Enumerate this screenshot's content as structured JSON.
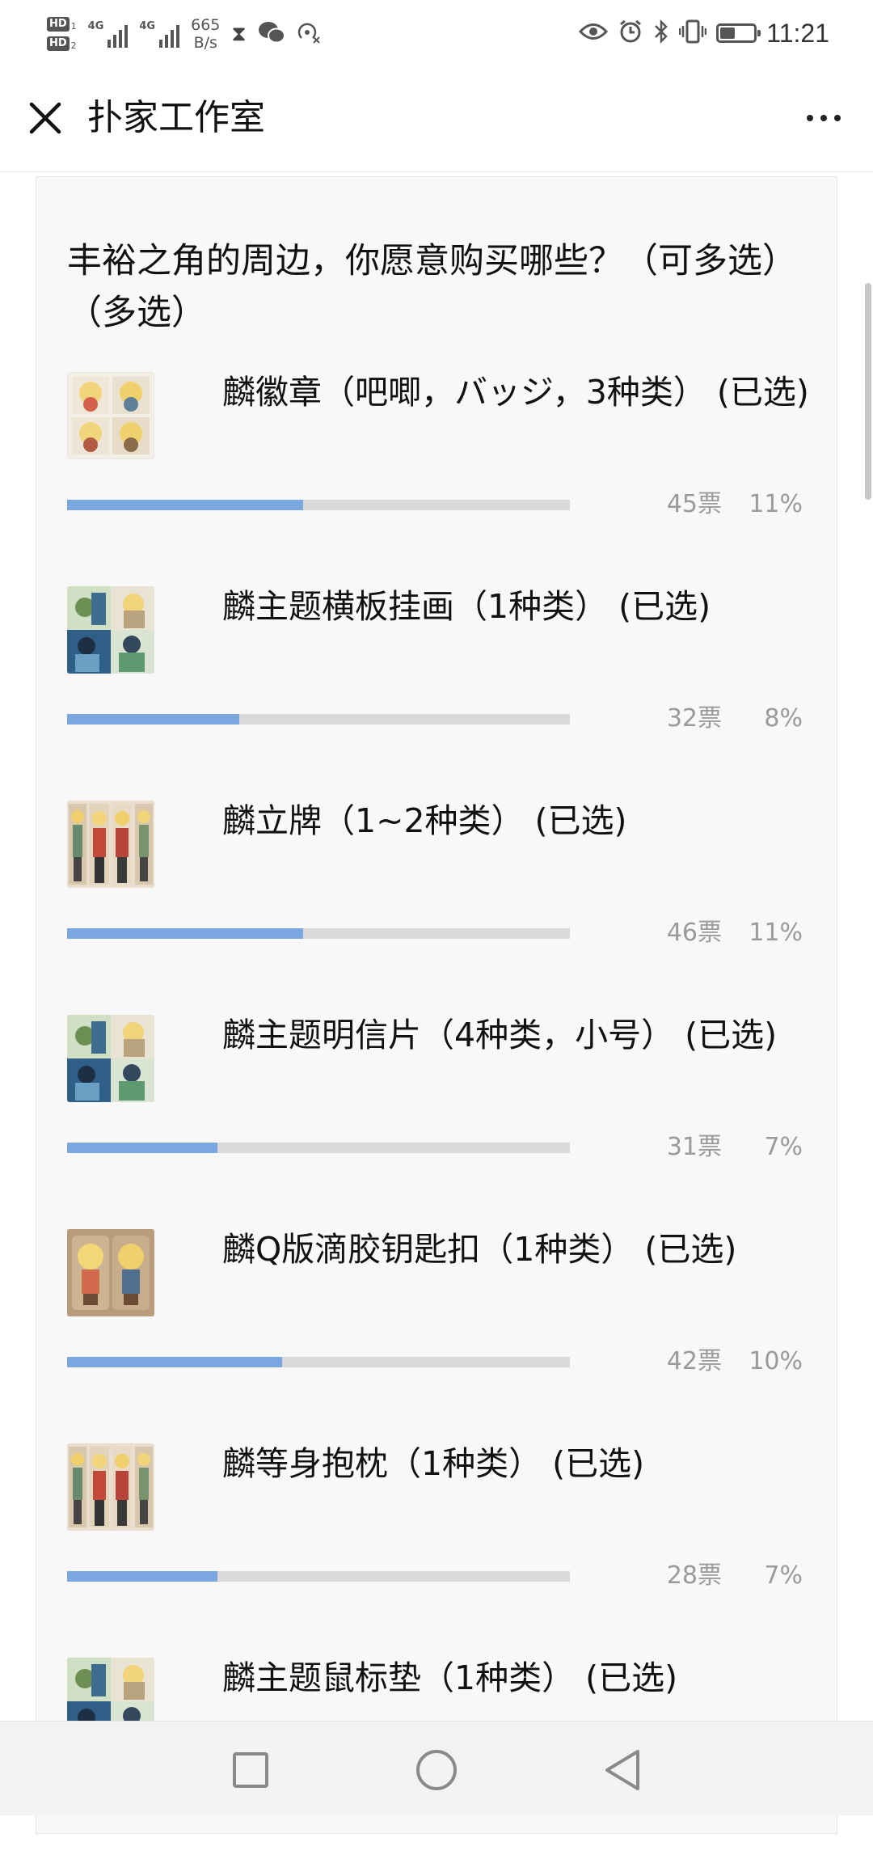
{
  "status_bar": {
    "hd1": "HD",
    "hd1_num": "1",
    "hd2": "HD",
    "hd2_num": "2",
    "net1": "4G",
    "net2": "4G",
    "speed_value": "665",
    "speed_unit": "B/s",
    "time": "11:21",
    "battery_level": 0.45,
    "icons_left": [
      "hourglass-icon",
      "wechat-icon",
      "hotspot-off-icon"
    ],
    "icons_right": [
      "eye-icon",
      "alarm-icon",
      "bluetooth-icon",
      "vibrate-icon",
      "battery-icon"
    ]
  },
  "nav": {
    "title": "扑家工作室",
    "close_icon": "close-icon",
    "more_icon": "more-icon"
  },
  "poll": {
    "question": "丰裕之角的周边，你愿意购买哪些？（可多选）（多选）",
    "options": [
      {
        "label": "麟徽章（吧唧，バッジ，3种类） (已选)",
        "votes": "45票",
        "percent": "11%",
        "fraction": 0.11,
        "thumb": "badges"
      },
      {
        "label": "麟主题横板挂画（1种类） (已选)",
        "votes": "32票",
        "percent": "8%",
        "fraction": 0.08,
        "thumb": "grid"
      },
      {
        "label": "麟立牌（1~2种类） (已选)",
        "votes": "46票",
        "percent": "11%",
        "fraction": 0.11,
        "thumb": "standees"
      },
      {
        "label": "麟主题明信片（4种类，小号） (已选)",
        "votes": "31票",
        "percent": "7%",
        "fraction": 0.07,
        "thumb": "grid"
      },
      {
        "label": "麟Q版滴胶钥匙扣（1种类） (已选)",
        "votes": "42票",
        "percent": "10%",
        "fraction": 0.1,
        "thumb": "keychain"
      },
      {
        "label": "麟等身抱枕（1种类） (已选)",
        "votes": "28票",
        "percent": "7%",
        "fraction": 0.07,
        "thumb": "standees"
      },
      {
        "label": "麟主题鼠标垫（1种类） (已选)",
        "votes": "",
        "percent": "",
        "fraction": 0,
        "thumb": "grid"
      }
    ]
  },
  "system_nav": {
    "recents_icon": "square-icon",
    "home_icon": "circle-icon",
    "back_icon": "back-triangle-icon"
  }
}
